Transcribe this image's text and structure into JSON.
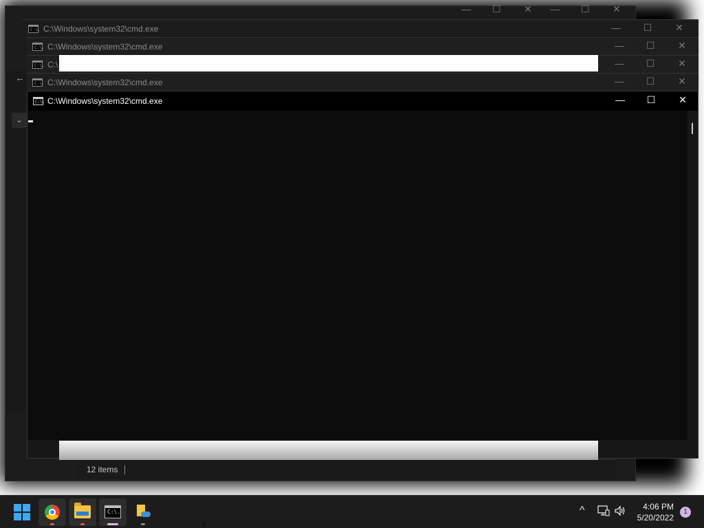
{
  "windows": {
    "cmd_title": "C:\\Windows\\system32\\cmd.exe",
    "cmd_title_short": "C:\\",
    "icon_label": "C:\\."
  },
  "explorer": {
    "status_text": "12 items"
  },
  "window_controls": {
    "minimize": "—",
    "maximize": "☐",
    "close": "✕"
  },
  "taskbar": {
    "apps": [
      {
        "name": "Start",
        "icon": "windows-start-icon"
      },
      {
        "name": "Google Chrome",
        "icon": "chrome-icon"
      },
      {
        "name": "File Explorer",
        "icon": "folder-icon"
      },
      {
        "name": "Command Prompt",
        "icon": "terminal-icon"
      },
      {
        "name": "OneDrive Files",
        "icon": "onedrive-icon"
      }
    ],
    "tray": {
      "chevron": "^",
      "time": "4:06 PM",
      "date": "5/20/2022",
      "notification_count": "1"
    }
  },
  "colors": {
    "start_blue": "#3ea8f2",
    "console_bg": "#0c0c0c",
    "taskbar_bg": "#1c1c1c"
  }
}
